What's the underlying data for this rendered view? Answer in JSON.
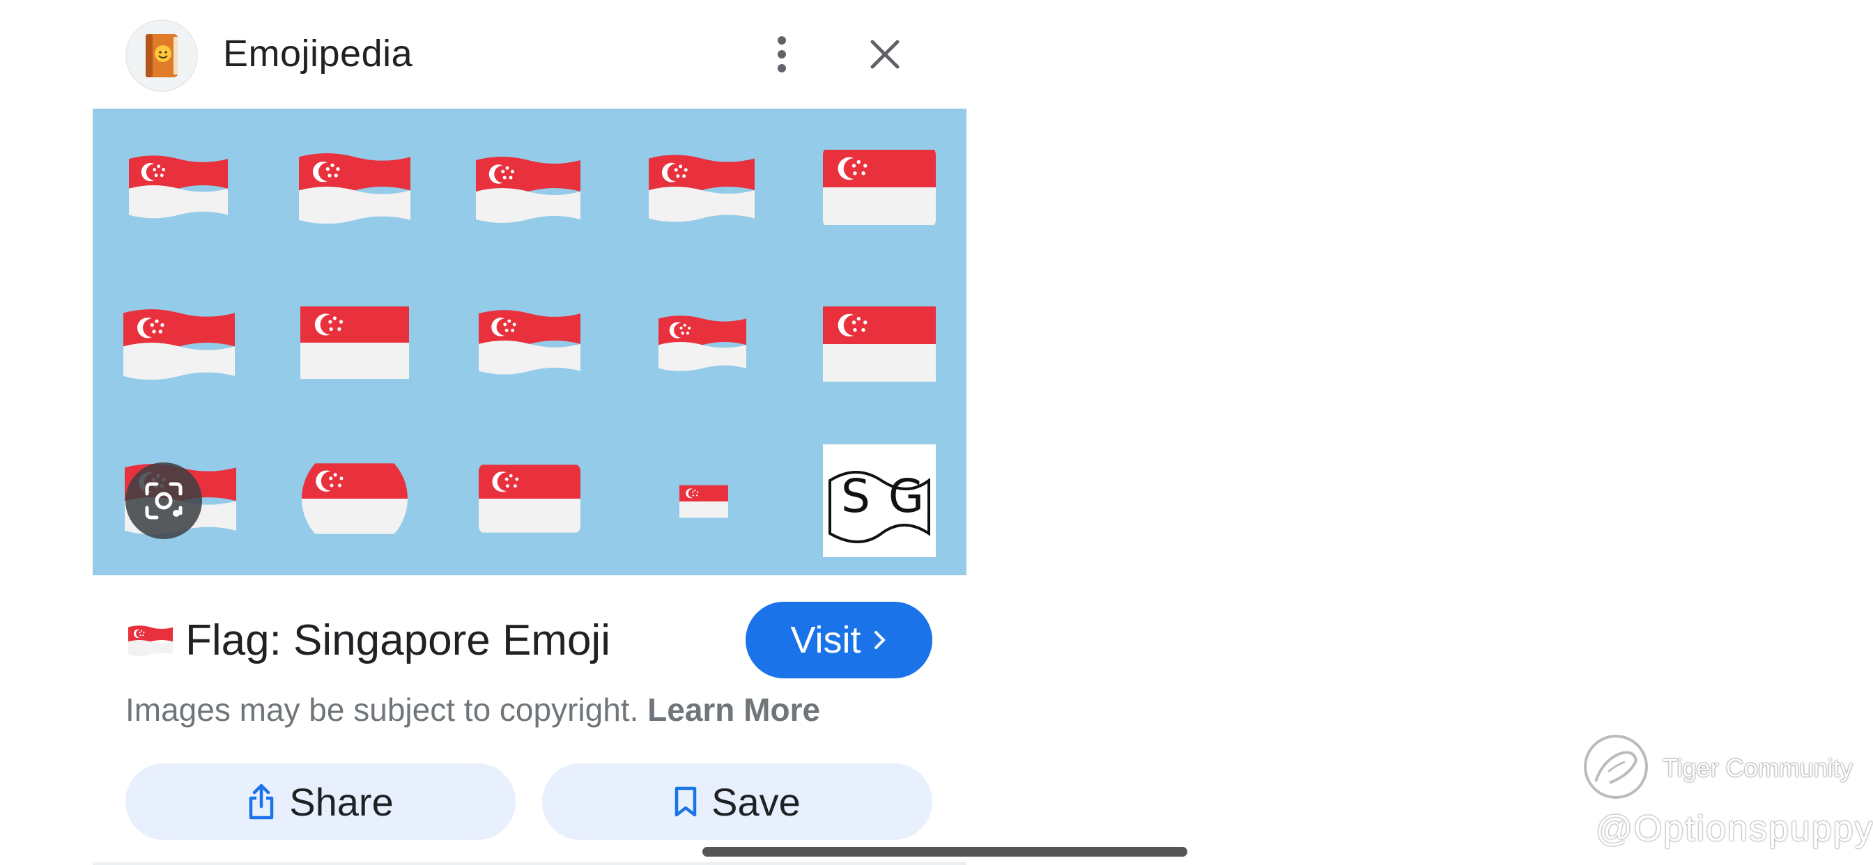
{
  "header": {
    "site_name": "Emojipedia",
    "site_icon": "emojipedia-book-icon",
    "menu_icon": "more-vert-icon",
    "close_icon": "close-icon"
  },
  "image_grid": {
    "background": "#94cbe9",
    "flag_red": "#e8313d",
    "flag_white": "#f2f2f2",
    "last_tile_text": "SG",
    "lens_icon": "google-lens-icon"
  },
  "info": {
    "title": "Flag: Singapore Emoji",
    "visit_label": "Visit",
    "visit_icon": "chevron-right-icon",
    "copyright_text": "Images may be subject to copyright.",
    "learn_more": "Learn More"
  },
  "actions": {
    "share_label": "Share",
    "share_icon": "share-icon",
    "save_label": "Save",
    "save_icon": "bookmark-icon"
  },
  "watermark": {
    "name": "Tiger Community",
    "handle": "@Optionspuppy"
  },
  "colors": {
    "accent": "#1a73e8",
    "button_bg": "#e8f0fe",
    "text_secondary": "#70757a"
  }
}
